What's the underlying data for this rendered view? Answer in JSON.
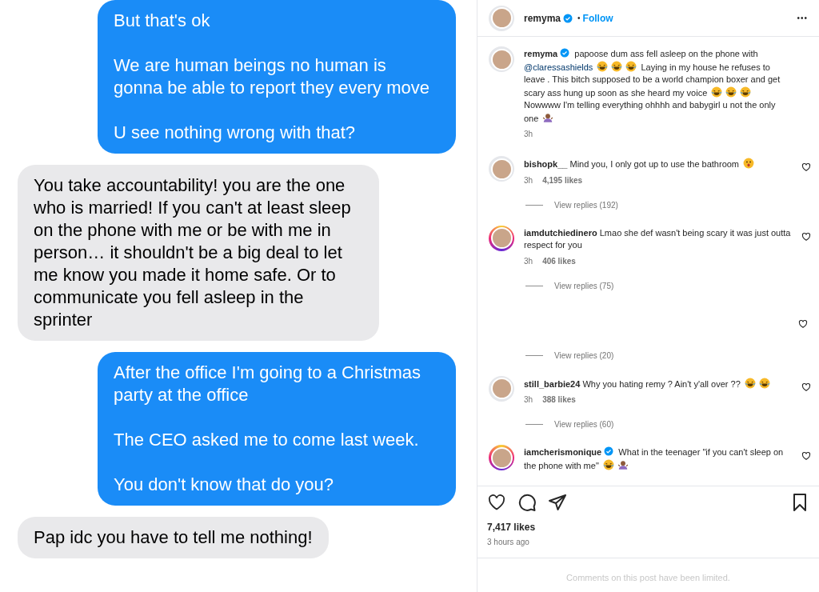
{
  "messages": [
    {
      "kind": "sent",
      "paragraphs": [
        "But that's ok",
        "We are human beings no human is gonna be able to report they every move",
        "U see nothing wrong with that?"
      ]
    },
    {
      "kind": "received",
      "paragraphs": [
        "You take accountability! you are the one who is married! If you can't at least sleep on the phone with me or be with me in person… it shouldn't be a big deal to let me know you made it home safe. Or to communicate you fell asleep in the sprinter"
      ]
    },
    {
      "kind": "sent",
      "paragraphs": [
        "After the office I'm going to a Christmas party at the office",
        "The CEO asked me to come last week.",
        "You don't know that do you?"
      ]
    },
    {
      "kind": "received",
      "paragraphs": [
        "Pap idc you have to tell me nothing!"
      ]
    }
  ],
  "post_header": {
    "username": "remyma",
    "verified": true,
    "separator": "•",
    "follow": "Follow",
    "more": "•••"
  },
  "caption": {
    "username": "remyma",
    "verified": true,
    "parts": [
      {
        "kind": "text",
        "text": "papoose dum ass fell asleep on the phone with"
      },
      {
        "kind": "mention",
        "text": "@claressashields"
      },
      {
        "kind": "laugh"
      },
      {
        "kind": "laugh"
      },
      {
        "kind": "laugh"
      },
      {
        "kind": "text",
        "text": "Laying in my house he refuses to leave . This bitch supposed to be a world champion boxer and get scary ass hung up soon as she heard my voice"
      },
      {
        "kind": "laugh"
      },
      {
        "kind": "laugh"
      },
      {
        "kind": "laugh"
      },
      {
        "kind": "text",
        "text": "Nowwww I'm telling everything ohhhh and babygirl u not the only one"
      },
      {
        "kind": "shrug"
      }
    ],
    "time": "3h"
  },
  "comments": [
    {
      "username": "bishopk__",
      "verified": false,
      "story_ring": false,
      "parts": [
        {
          "kind": "text",
          "text": "Mind you, I only got up to use the bathroom"
        },
        {
          "kind": "shocked"
        }
      ],
      "time": "3h",
      "likes": "4,195 likes",
      "replies": "View replies (192)"
    },
    {
      "username": "iamdutchiedinero",
      "verified": false,
      "story_ring": true,
      "parts": [
        {
          "kind": "text",
          "text": "Lmao she def wasn't being scary it was just outta respect for you"
        }
      ],
      "time": "3h",
      "likes": "406 likes",
      "replies": "View replies (75)"
    },
    {
      "replies": "View replies (20)"
    },
    {
      "username": "still_barbie24",
      "verified": false,
      "story_ring": false,
      "parts": [
        {
          "kind": "text",
          "text": "Why you hating remy ? Ain't y'all over ??"
        },
        {
          "kind": "laugh"
        },
        {
          "kind": "laugh"
        }
      ],
      "time": "3h",
      "likes": "388 likes",
      "replies": "View replies (60)"
    },
    {
      "username": "iamcherismonique",
      "verified": true,
      "story_ring": true,
      "parts": [
        {
          "kind": "text",
          "text": "What in the teenager \"if you can't sleep on the phone with me\""
        },
        {
          "kind": "laugh"
        },
        {
          "kind": "shrug"
        }
      ]
    }
  ],
  "likes": "7,417 likes",
  "posted": "3 hours ago",
  "limited_notice": "Comments on this post have been limited."
}
